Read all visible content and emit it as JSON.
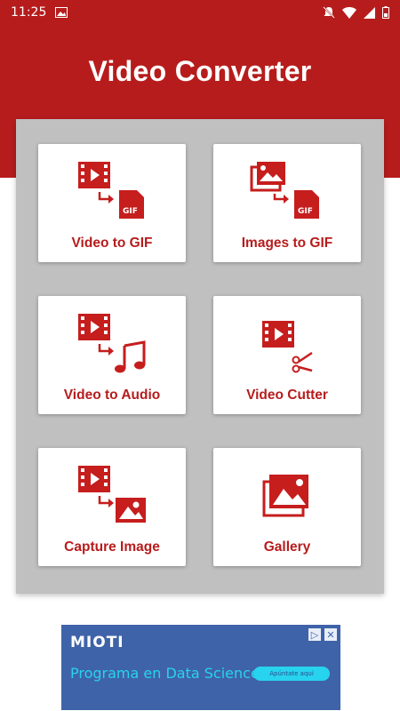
{
  "status_bar": {
    "time": "11:25"
  },
  "header": {
    "title": "Video Converter"
  },
  "tiles": [
    {
      "label": "Video to GIF",
      "icon": "video-to-gif-icon"
    },
    {
      "label": "Images to GIF",
      "icon": "images-to-gif-icon"
    },
    {
      "label": "Video to Audio",
      "icon": "video-to-audio-icon"
    },
    {
      "label": "Video Cutter",
      "icon": "video-cutter-icon"
    },
    {
      "label": "Capture Image",
      "icon": "capture-image-icon"
    },
    {
      "label": "Gallery",
      "icon": "gallery-icon"
    }
  ],
  "ad": {
    "brand": "MIOTI",
    "text": "Programa en Data Science",
    "cta": "Apúntate aquí"
  },
  "colors": {
    "primary": "#b71c1c",
    "panel": "#c0c0c0",
    "ad_bg": "#3f63a8",
    "ad_accent": "#27d3ee"
  }
}
